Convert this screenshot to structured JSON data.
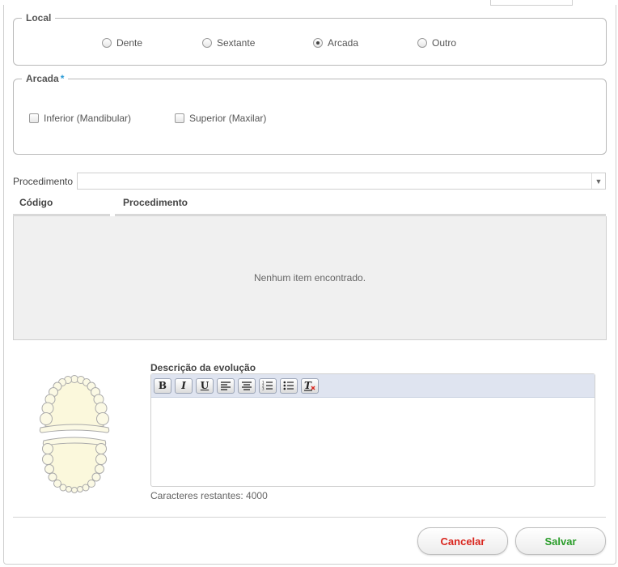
{
  "local": {
    "legend": "Local",
    "options": [
      {
        "label": "Dente",
        "selected": false
      },
      {
        "label": "Sextante",
        "selected": false
      },
      {
        "label": "Arcada",
        "selected": true
      },
      {
        "label": "Outro",
        "selected": false
      }
    ]
  },
  "arcada": {
    "legend": "Arcada",
    "required_mark": "*",
    "options": [
      {
        "label": "Inferior (Mandibular)",
        "checked": false
      },
      {
        "label": "Superior (Maxilar)",
        "checked": false
      }
    ]
  },
  "procedimento": {
    "label": "Procedimento",
    "value": ""
  },
  "table": {
    "columns": [
      "Código",
      "Procedimento"
    ],
    "empty_message": "Nenhum item encontrado."
  },
  "evolucao": {
    "label": "Descrição da evolução",
    "value": "",
    "toolbar": [
      {
        "name": "bold-icon",
        "glyph": "B"
      },
      {
        "name": "italic-icon",
        "glyph": "I"
      },
      {
        "name": "underline-icon",
        "glyph": "U"
      },
      {
        "name": "align-left-icon",
        "glyph": "align-left"
      },
      {
        "name": "align-center-icon",
        "glyph": "align-center"
      },
      {
        "name": "ordered-list-icon",
        "glyph": "ordered-list"
      },
      {
        "name": "unordered-list-icon",
        "glyph": "unordered-list"
      },
      {
        "name": "remove-format-icon",
        "glyph": "T"
      }
    ],
    "chars_remaining": "Caracteres restantes: 4000"
  },
  "actions": {
    "cancel_label": "Cancelar",
    "save_label": "Salvar"
  },
  "colors": {
    "cancel": "#d9251d",
    "save": "#2a9d2a",
    "required": "#2a9bd6",
    "toolbar_bg": "#dfe4f0"
  }
}
